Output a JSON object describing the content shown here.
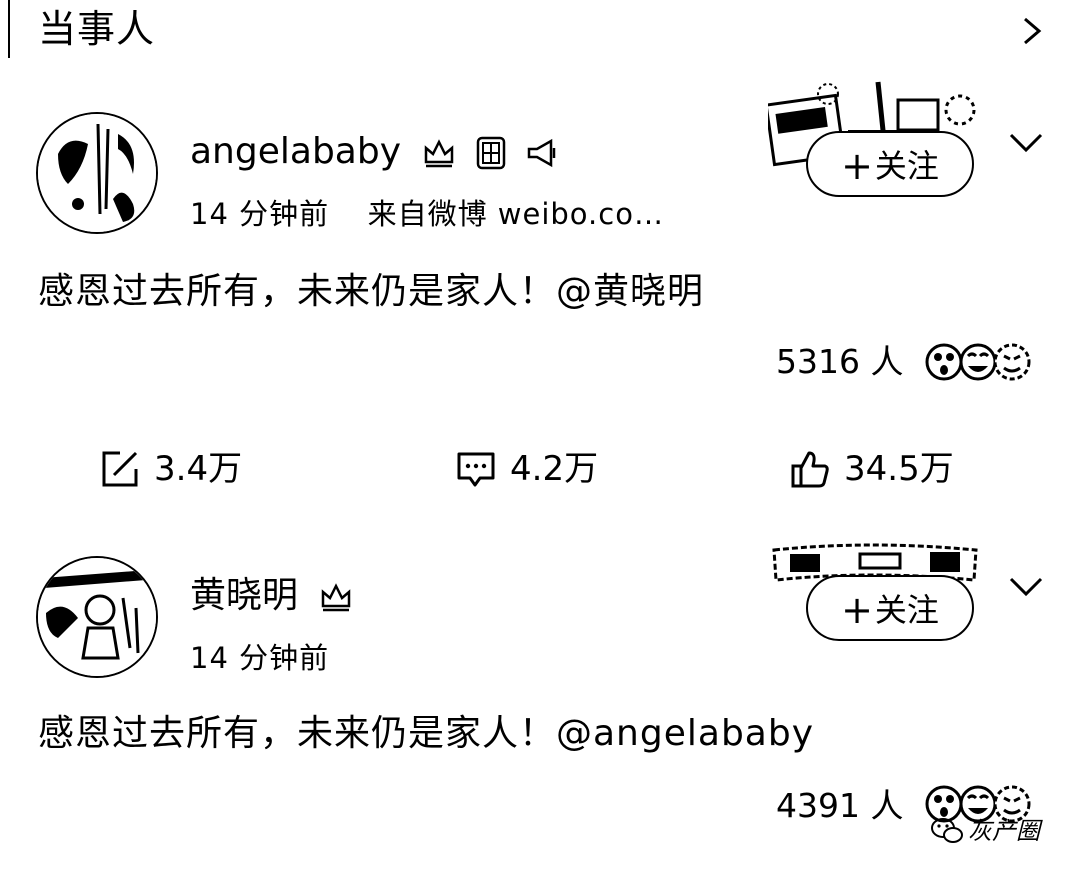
{
  "section": {
    "title": "当事人"
  },
  "posts": [
    {
      "author": "angelababy",
      "time": "14 分钟前",
      "source": "来自微博 weibo.co…",
      "follow_label": "关注",
      "content": "感恩过去所有，未来仍是家人！@黄晓明",
      "reaction_count": "5316 人",
      "badges": [
        "crown-icon",
        "fu-badge-icon",
        "megaphone-icon"
      ],
      "actions": {
        "repost": "3.4万",
        "comment": "4.2万",
        "like": "34.5万"
      }
    },
    {
      "author": "黄晓明",
      "time": "14 分钟前",
      "follow_label": "关注",
      "content": "感恩过去所有，未来仍是家人！@angelababy",
      "reaction_count": "4391 人",
      "badges": [
        "crown-icon"
      ]
    }
  ],
  "watermark": {
    "text": "灰产圈"
  }
}
